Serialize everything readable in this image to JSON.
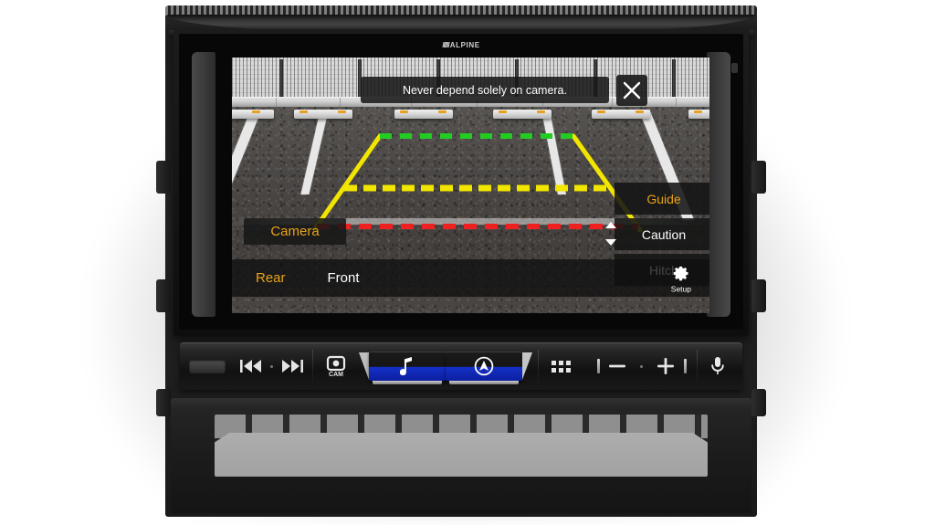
{
  "device": {
    "brand": "ALPINE",
    "brand_mark": "//////"
  },
  "screen": {
    "warning_banner": {
      "text": "Never depend solely on camera.",
      "close_icon": "close-icon"
    },
    "camera_chip": {
      "label": "Camera"
    },
    "side_menu": {
      "items": [
        {
          "label": "Guide",
          "active": true,
          "color": "#e8a317"
        },
        {
          "label": "Caution",
          "active": false,
          "color": "#ffffff"
        },
        {
          "label": "Hitch",
          "active": false,
          "color": "#ffffff"
        }
      ],
      "stepper": {
        "up_icon": "triangle-up-icon",
        "down_icon": "triangle-down-icon"
      }
    },
    "bottom_bar": {
      "rear_label": "Rear",
      "front_label": "Front",
      "setup_label": "Setup",
      "setup_icon": "gear-icon"
    },
    "guides": {
      "far_line_color": "#22cc22",
      "mid_line_color": "#f2e500",
      "near_line_color": "#ee2020",
      "side_line_color": "#f2e500"
    }
  },
  "controls": {
    "buttons": [
      {
        "name": "eject-slot",
        "label": "",
        "icon": "eject-slot-icon"
      },
      {
        "name": "previous-track",
        "label": "",
        "icon": "previous-track-icon"
      },
      {
        "name": "next-track",
        "label": "",
        "icon": "next-track-icon"
      },
      {
        "name": "camera",
        "label": "CAM",
        "icon": "camera-icon"
      },
      {
        "name": "audio",
        "label": "",
        "icon": "music-note-icon"
      },
      {
        "name": "navigation",
        "label": "",
        "icon": "navigation-arrow-icon"
      },
      {
        "name": "apps",
        "label": "",
        "icon": "apps-grid-icon"
      },
      {
        "name": "volume-down",
        "label": "",
        "icon": "minus-icon"
      },
      {
        "name": "volume-up",
        "label": "",
        "icon": "plus-icon"
      },
      {
        "name": "voice",
        "label": "",
        "icon": "microphone-icon"
      }
    ],
    "cam_label": "CAM"
  },
  "colors": {
    "accent_amber": "#e8a317",
    "button_blue": "#1430c8",
    "screen_text": "#ffffff"
  }
}
